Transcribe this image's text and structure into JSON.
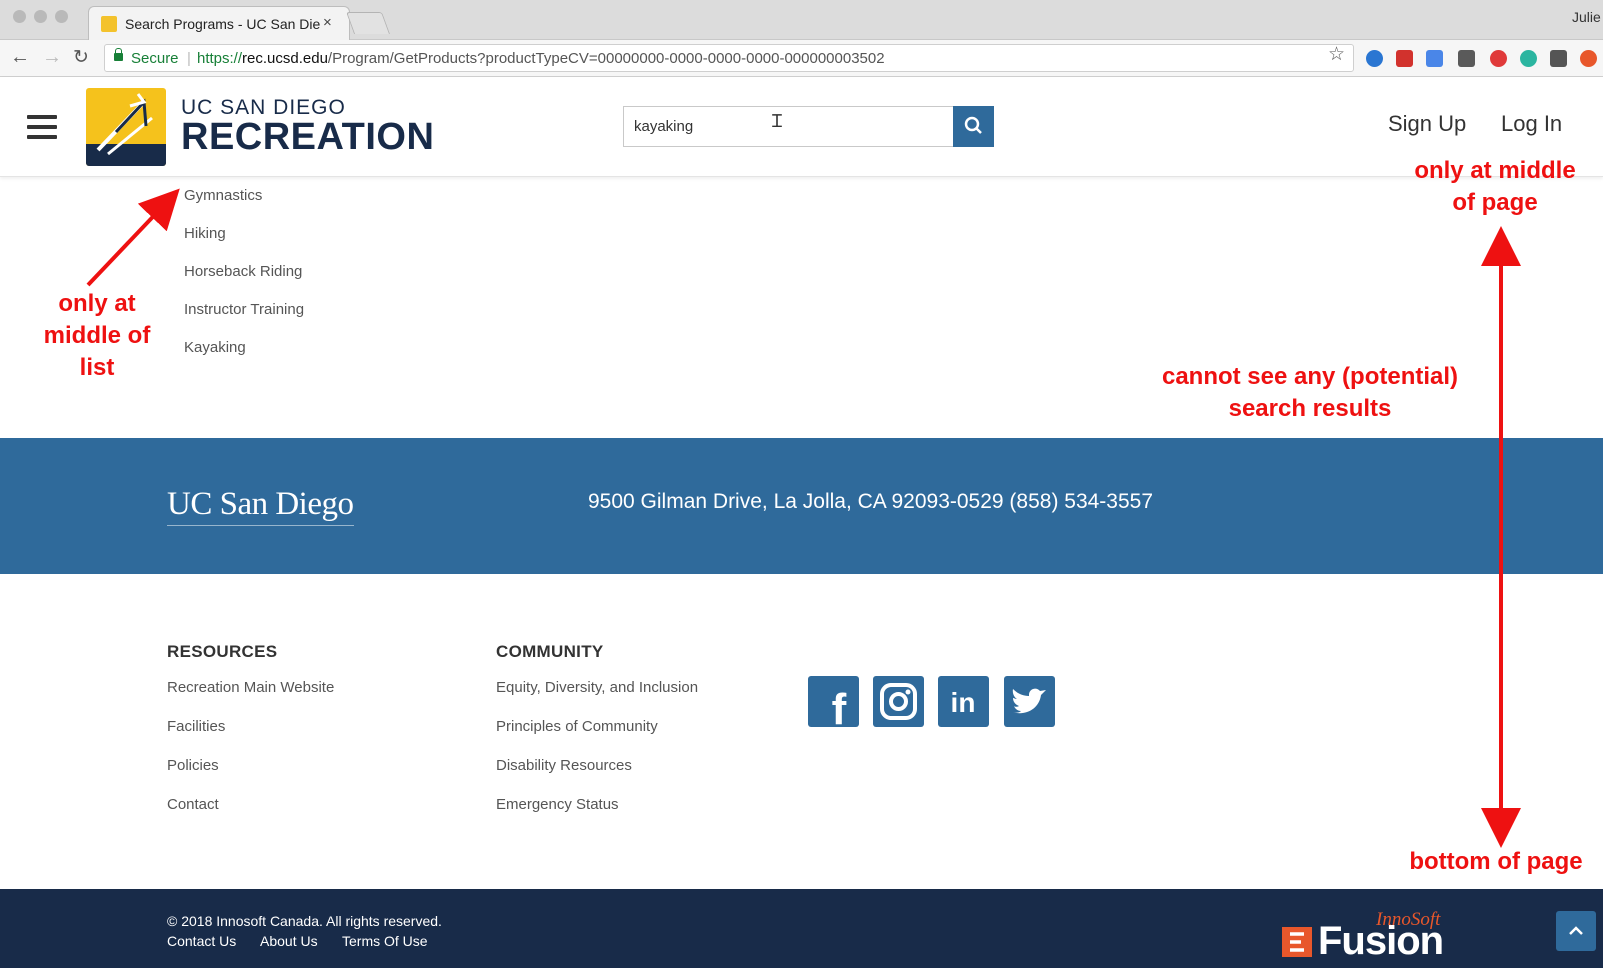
{
  "browser": {
    "tab_title": "Search Programs - UC San Die",
    "tab_close": "×",
    "profile_name": "Julie",
    "secure_label": "Secure",
    "url_scheme": "https://",
    "url_host": "rec.ucsd.edu",
    "url_path": "/Program/GetProducts?productTypeCV=00000000-0000-0000-0000-000000003502",
    "extension_colors": [
      "#2a76d2",
      "#d2322d",
      "#4a86e8",
      "#5a5a5a",
      "#e03a3a",
      "#2bb5a0",
      "#555555",
      "#e8572b"
    ]
  },
  "header": {
    "logo_line1": "UC SAN DIEGO",
    "logo_line2": "RECREATION",
    "search_value": "kayaking",
    "signup_label": "Sign Up",
    "login_label": "Log In"
  },
  "categories": [
    "Gymnastics",
    "Hiking",
    "Horseback Riding",
    "Instructor Training",
    "Kayaking"
  ],
  "annotations": {
    "list_note": [
      "only at",
      "middle of",
      "list"
    ],
    "page_note": [
      "only at middle",
      "of page"
    ],
    "results_note": [
      "cannot see any (potential)",
      "search results"
    ],
    "bottom_note": "bottom of page",
    "color": "#ee1111"
  },
  "band": {
    "wordmark": "UC San Diego",
    "address": "9500 Gilman Drive, La Jolla, CA 92093-0529 (858) 534-3557"
  },
  "footer": {
    "resources_heading": "RESOURCES",
    "resources": [
      "Recreation Main Website",
      "Facilities",
      "Policies",
      "Contact"
    ],
    "community_heading": "COMMUNITY",
    "community": [
      "Equity, Diversity, and Inclusion",
      "Principles of Community",
      "Disability Resources",
      "Emergency Status"
    ],
    "social": [
      "facebook",
      "instagram",
      "linkedin",
      "twitter"
    ]
  },
  "bottom": {
    "copyright": "© 2018 Innosoft Canada. All rights reserved.",
    "links": [
      "Contact Us",
      "About Us",
      "Terms Of Use"
    ],
    "brand_small": "InnoSoft",
    "brand_large": "Fusion"
  },
  "colors": {
    "ucsd_blue": "#2f6a9b",
    "ucsd_navy": "#182b49",
    "ucsd_gold": "#f5c21c"
  }
}
